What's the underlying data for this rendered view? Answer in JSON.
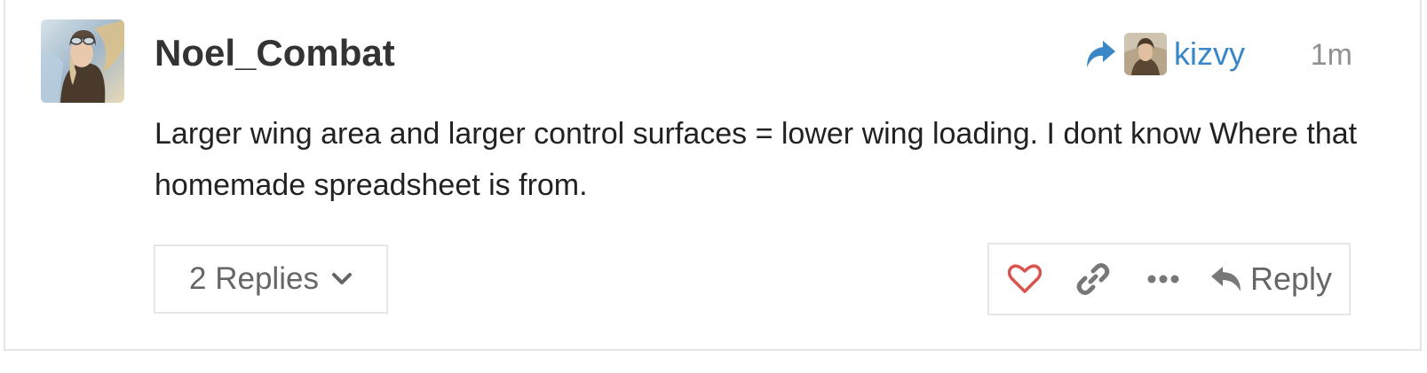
{
  "post": {
    "username": "Noel_Combat",
    "reply_to": {
      "name": "kizvy"
    },
    "date": "1m",
    "body": "Larger wing area and larger control surfaces = lower wing loading. I dont know Where that homemade spreadsheet is from.",
    "replies_label": "2 Replies",
    "actions": {
      "reply_label": "Reply"
    }
  },
  "colors": {
    "link_blue": "#3a87c8",
    "like_red": "#d9534f",
    "muted_grey": "#919191",
    "border": "#e6e6e6"
  },
  "icons": [
    "share-arrow-icon",
    "chevron-down-icon",
    "heart-icon",
    "link-icon",
    "ellipsis-icon",
    "reply-arrow-icon"
  ]
}
